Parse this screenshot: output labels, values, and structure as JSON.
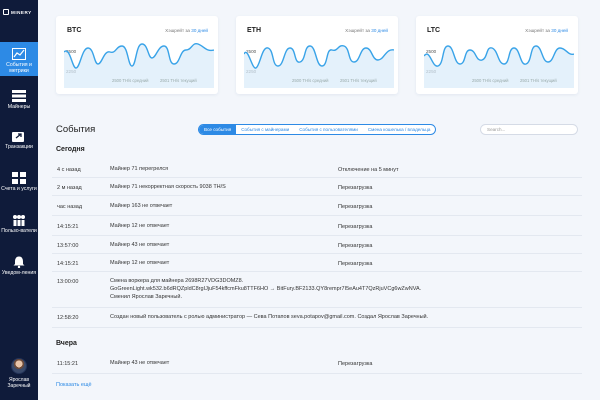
{
  "app": {
    "logo": "MINERY"
  },
  "sidebar": {
    "items": [
      {
        "label": "События и метрики",
        "icon": "chart-line-icon",
        "active": true
      },
      {
        "label": "Майнеры",
        "icon": "server-icon",
        "active": false
      },
      {
        "label": "Транзакции",
        "icon": "share-icon",
        "active": false
      },
      {
        "label": "Счета и услуги",
        "icon": "grid-icon",
        "active": false
      },
      {
        "label": "Пользо-ватели",
        "icon": "users-icon",
        "active": false
      },
      {
        "label": "Уведом-ления",
        "icon": "bell-icon",
        "active": false
      }
    ],
    "user": {
      "name": "Ярослав Заречный"
    }
  },
  "cards": [
    {
      "coin": "BTC",
      "hashrate_label": "Хэшрейт за",
      "period": "30 дней",
      "y_ticks": [
        "2500",
        "2250"
      ],
      "legend": [
        "2500 TH/s средний",
        "2501 TH/s текущий"
      ]
    },
    {
      "coin": "ETH",
      "hashrate_label": "Хэшрейт за",
      "period": "30 дней",
      "y_ticks": [
        "2500",
        "2250"
      ],
      "legend": [
        "2500 TH/s средний",
        "2501 TH/s текущий"
      ]
    },
    {
      "coin": "LTC",
      "hashrate_label": "Хэшрейт за",
      "period": "30 дней",
      "y_ticks": [
        "2500",
        "2250"
      ],
      "legend": [
        "2500 TH/s средний",
        "2501 TH/s текущий"
      ]
    }
  ],
  "colors": {
    "accent": "#2d8ae5",
    "sidebar": "#0f1b3a",
    "line": "#39a3e8"
  },
  "events": {
    "title": "События",
    "tabs": [
      {
        "label": "Все события",
        "active": true
      },
      {
        "label": "События с майнерами",
        "active": false
      },
      {
        "label": "События с пользователями",
        "active": false
      },
      {
        "label": "Смена кошелька / владельца",
        "active": false
      }
    ],
    "search_placeholder": "Search...",
    "today_title": "Сегодня",
    "yesterday_title": "Вчера",
    "today": [
      {
        "time": "4 с назад",
        "message": "Майнер 71 перегрелся",
        "action": "Отключение на 5 минут"
      },
      {
        "time": "2 м назад",
        "message": "Майнер 71 некорректная скорость 9038 TH/S",
        "action": "Перезагрузка"
      },
      {
        "time": "час назад",
        "message": "Майнер 163 не отвечает",
        "action": "Перезагрузка"
      },
      {
        "time": "14:15:21",
        "message": "Майнер 12 не отвечает",
        "action": "Перезагрузка"
      },
      {
        "time": "13:57:00",
        "message": "Майнер 43 не отвечает",
        "action": "Перезагрузка"
      },
      {
        "time": "14:15:21",
        "message": "Майнер 12 не отвечает",
        "action": "Перезагрузка"
      },
      {
        "time": "13:00:00",
        "message": "Смена воркера для майнера 2698R27VDG3DOMZ8.",
        "message2": "GoGreenLight.wk532.b6dRQZpldC8rgIJjuF54kffcmFku8TTF6HO → BitFury.BF2133.QY8rempr7I5eAu4T7QzRjuVCg6wZwNVA.",
        "message3": "Сменил Ярослав Заречный.",
        "action": ""
      },
      {
        "time": "12:58:20",
        "message": "Создан новый пользователь с ролью администратор — Сева Потапов seva.potapov@gmail.com. Создал Ярослав Заречный.",
        "action": ""
      }
    ],
    "yesterday": [
      {
        "time": "11:15:21",
        "message": "Майнер 43 не отвечает",
        "action": "Перезагрузка"
      }
    ],
    "show_more": "Показать ещё"
  }
}
